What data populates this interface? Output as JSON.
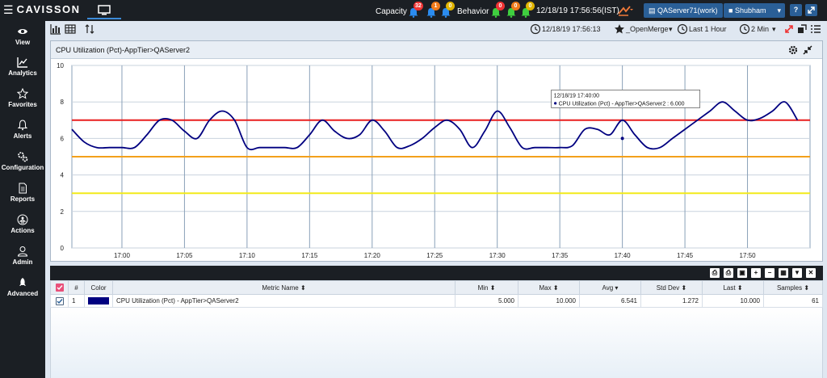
{
  "app": {
    "logo": "CAVISSON"
  },
  "topbar": {
    "capacity_label": "Capacity",
    "capacity_badges": [
      "32",
      "1",
      "0"
    ],
    "behavior_label": "Behavior",
    "behavior_badges": [
      "0",
      "0",
      "0"
    ],
    "timestamp": "12/18/19 17:56:56(IST)",
    "server": "QAServer71(work)",
    "user": "Shubham",
    "help_label": "?"
  },
  "sidebar": {
    "items": [
      {
        "label": "View",
        "icon": "eye-icon"
      },
      {
        "label": "Analytics",
        "icon": "chart-line-icon"
      },
      {
        "label": "Favorites",
        "icon": "star-icon"
      },
      {
        "label": "Alerts",
        "icon": "bell-icon"
      },
      {
        "label": "Configuration",
        "icon": "gears-icon"
      },
      {
        "label": "Reports",
        "icon": "document-icon"
      },
      {
        "label": "Actions",
        "icon": "person-circle-icon"
      },
      {
        "label": "Admin",
        "icon": "user-icon"
      },
      {
        "label": "Advanced",
        "icon": "rocket-icon"
      }
    ]
  },
  "toolbar": {
    "time": "12/18/19 17:56:13",
    "favorite": "_OpenMerge",
    "duration": "Last 1 Hour",
    "interval": "2 Min"
  },
  "panel": {
    "title": "CPU Utilization (Pct)-AppTier>QAServer2"
  },
  "chart_data": {
    "type": "line",
    "ylim": [
      0,
      10
    ],
    "yticks": [
      0,
      2,
      4,
      6,
      8,
      10
    ],
    "xlim": [
      "16:56",
      "17:55"
    ],
    "xticks": [
      "17:00",
      "17:05",
      "17:10",
      "17:15",
      "17:20",
      "17:25",
      "17:30",
      "17:35",
      "17:40",
      "17:45",
      "17:50"
    ],
    "grid": true,
    "series": [
      {
        "color": "#000080",
        "x": [
          "16:56",
          "16:57",
          "16:58",
          "16:59",
          "17:00",
          "17:01",
          "17:02",
          "17:03",
          "17:04",
          "17:05",
          "17:06",
          "17:07",
          "17:08",
          "17:09",
          "17:10",
          "17:11",
          "17:12",
          "17:13",
          "17:14",
          "17:15",
          "17:16",
          "17:17",
          "17:18",
          "17:19",
          "17:20",
          "17:21",
          "17:22",
          "17:23",
          "17:24",
          "17:25",
          "17:26",
          "17:27",
          "17:28",
          "17:29",
          "17:30",
          "17:31",
          "17:32",
          "17:33",
          "17:34",
          "17:35",
          "17:36",
          "17:37",
          "17:38",
          "17:39",
          "17:40",
          "17:41",
          "17:42",
          "17:43",
          "17:44",
          "17:45",
          "17:46",
          "17:47",
          "17:48",
          "17:49",
          "17:50",
          "17:51",
          "17:52",
          "17:53",
          "17:54"
        ],
        "y": [
          6.5,
          5.8,
          5.5,
          5.5,
          5.5,
          5.5,
          6.2,
          7.0,
          7.0,
          6.4,
          6.0,
          7.0,
          7.5,
          7.0,
          5.5,
          5.5,
          5.5,
          5.5,
          5.5,
          6.2,
          7.0,
          6.4,
          6.0,
          6.2,
          7.0,
          6.4,
          5.5,
          5.6,
          6.0,
          6.6,
          7.0,
          6.5,
          5.5,
          6.4,
          7.5,
          6.6,
          5.5,
          5.5,
          5.5,
          5.5,
          5.6,
          6.5,
          6.5,
          6.2,
          7.0,
          6.2,
          5.5,
          5.5,
          6.0,
          6.5,
          7.0,
          7.5,
          8.0,
          7.5,
          7.0,
          7.1,
          7.5,
          8.0,
          7.0
        ]
      }
    ],
    "thresholds": [
      {
        "y": 7,
        "color": "#e81e1e"
      },
      {
        "y": 5,
        "color": "#f3a01b"
      },
      {
        "y": 3,
        "color": "#f2ea1a"
      }
    ],
    "tooltip": {
      "time": "12/18/19 17:40:00",
      "text": "CPU Utilization (Pct) - AppTier>QAServer2 : 6.000",
      "x": "17:40",
      "y": 6.0
    }
  },
  "table": {
    "columns": [
      "#",
      "Color",
      "Metric Name",
      "Min",
      "Max",
      "Avg",
      "Std Dev",
      "Last",
      "Samples"
    ],
    "rows": [
      {
        "index": "1",
        "color": "#000080",
        "metric": "CPU Utilization (Pct) - AppTier>QAServer2",
        "min": "5.000",
        "max": "10.000",
        "avg": "6.541",
        "std": "1.272",
        "last": "10.000",
        "samples": "61"
      }
    ]
  },
  "colors": {
    "dark": "#1b1f24",
    "accent": "#2a5f97",
    "line": "#000080"
  }
}
